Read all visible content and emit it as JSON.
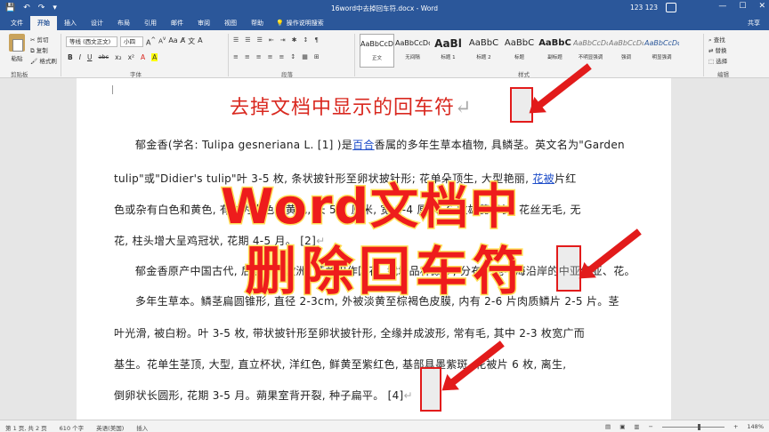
{
  "window": {
    "title": "16word中去掉回车符.docx - Word",
    "user": "123 123",
    "controls": [
      "—",
      "☐",
      "✕"
    ]
  },
  "quick_access": [
    "💾",
    "↶",
    "↷",
    "▾"
  ],
  "tabs": [
    "文件",
    "开始",
    "插入",
    "设计",
    "布局",
    "引用",
    "邮件",
    "审阅",
    "视图",
    "帮助"
  ],
  "active_tab": "开始",
  "tell_me": "操作说明搜索",
  "share": "共享",
  "ribbon": {
    "clipboard": {
      "paste": "粘贴",
      "cut": "剪切",
      "copy": "复制",
      "format_painter": "格式刷",
      "label": "剪贴板"
    },
    "font": {
      "name": "等线 (西文正文)",
      "size": "小四",
      "buttons": [
        "B",
        "I",
        "U",
        "abc",
        "x₂",
        "x²",
        "A",
        "A"
      ],
      "label": "字体"
    },
    "paragraph": {
      "row1": [
        "☰",
        "☰",
        "☰",
        "⇤",
        "⇥",
        "✱",
        "↕",
        "¶"
      ],
      "row2": [
        "≡",
        "≡",
        "≡",
        "≡",
        "≡",
        "↕",
        "▦",
        "⊞"
      ],
      "label": "段落"
    },
    "styles": {
      "items": [
        {
          "sample": "AaBbCcDc",
          "name": "正文"
        },
        {
          "sample": "AaBbCcDc",
          "name": "无间隔"
        },
        {
          "sample": "AaBl",
          "name": "标题 1"
        },
        {
          "sample": "AaBbC",
          "name": "标题 2"
        },
        {
          "sample": "AaBbC",
          "name": "标题"
        },
        {
          "sample": "AaBbC",
          "name": "副标题"
        },
        {
          "sample": "AaBbCcDc",
          "name": "不明显强调"
        },
        {
          "sample": "AaBbCcDc",
          "name": "强调"
        },
        {
          "sample": "AaBbCcDc",
          "name": "明显强调"
        }
      ],
      "label": "样式"
    },
    "editing": {
      "find": "查找",
      "replace": "替换",
      "select": "选择",
      "label": "编辑"
    }
  },
  "document": {
    "heading": "去掉文档中显示的回车符",
    "return_mark": "↵",
    "lines": [
      {
        "pre": "郁金香(学名: Tulipa gesneriana L. [1] )是",
        "link": "百合",
        "post": "香属的多年生草本植物, 具鳞茎。英文名为\"Garden"
      },
      {
        "pre": "tulip\"或\"Didier's tulip\"叶 3-5 枚, 条状披针形至卵状披针形; 花单朵顶生, 大型艳丽, ",
        "link": "花被",
        "post": "片红"
      },
      {
        "pre": "色或杂有白色和黄色, 有时为白色或黄色, 长 5-7 厘米, 宽 2-4 厘米, 6 枚雄蕊等长, 花丝无毛, 无"
      },
      {
        "pre": "花, 柱头增大呈鸡冠状, 花期 4-5 月。 [2]"
      },
      {
        "pre": "郁金香原产中国古代, 后被引入欧洲, 荷兰用作国花, 栽培品种颇多, 分布于地中海沿岸的中亚细亚、花。"
      },
      {
        "pre": "多年生草本。鳞茎扁圆锥形, 直径 2-3cm, 外被淡黄至棕褐色皮膜, 内有 2-6 片肉质鳞片 2-5 片。茎"
      },
      {
        "pre": "叶光滑, 被白粉。叶 3-5 枚, 带状披针形至卵状披针形, 全缘并成波形, 常有毛, 其中 2-3 枚宽广而"
      },
      {
        "pre": "基生。花单生茎顶, 大型, 直立杯状, 洋红色, 鲜黄至紫红色, 基部具墨紫斑, 花被片 6 枚, 离生,"
      },
      {
        "pre": "倒卵状长圆形, 花期 3-5 月。蒴果室背开裂, 种子扁平。 [4]"
      }
    ]
  },
  "overlay": {
    "line1": "Word文档中",
    "line2": "删除回车符"
  },
  "status": {
    "page": "第 1 页, 共 2 页",
    "words": "610 个字",
    "lang": "英语(美国)",
    "mode": "插入",
    "zoom": "148%"
  }
}
